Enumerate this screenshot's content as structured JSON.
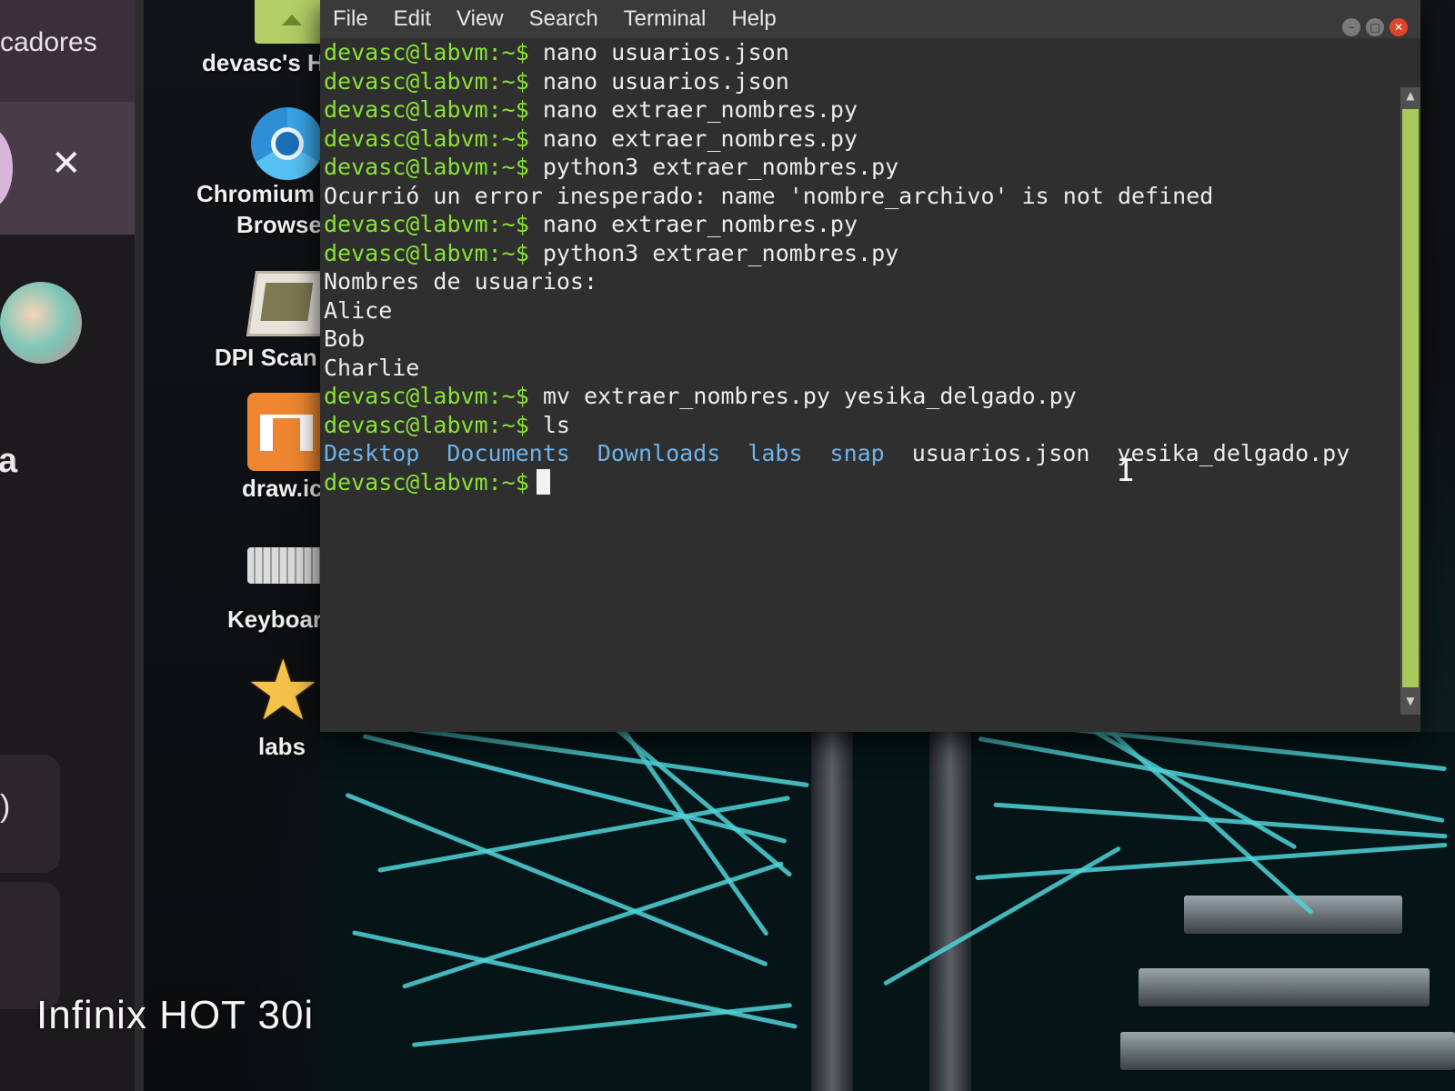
{
  "left_panel": {
    "bookmark_text": "cadores",
    "close_symbol": "✕",
    "letter": "a",
    "glyph": ")"
  },
  "desktop": {
    "items": [
      {
        "label": "devasc's H",
        "icon": "home-folder-icon"
      },
      {
        "label": "Chromium",
        "label2": "Browse",
        "icon": "chromium-icon"
      },
      {
        "label": "DPI Scan",
        "icon": "dpi-scan-icon"
      },
      {
        "label": "draw.ic",
        "icon": "drawio-icon"
      },
      {
        "label": "Keyboar",
        "icon": "keyboard-icon"
      },
      {
        "label": "labs",
        "icon": "star-icon"
      }
    ]
  },
  "terminal": {
    "menu": [
      "File",
      "Edit",
      "View",
      "Search",
      "Terminal",
      "Help"
    ],
    "prompt": "devasc@labvm:~$",
    "lines": [
      {
        "type": "cmd",
        "text": "nano usuarios.json"
      },
      {
        "type": "cmd",
        "text": "nano usuarios.json"
      },
      {
        "type": "cmd",
        "text": "nano extraer_nombres.py"
      },
      {
        "type": "cmd",
        "text": "nano extraer_nombres.py"
      },
      {
        "type": "cmd",
        "text": "python3 extraer_nombres.py"
      },
      {
        "type": "out",
        "text": "Ocurrió un error inesperado: name 'nombre_archivo' is not defined"
      },
      {
        "type": "cmd",
        "text": "nano extraer_nombres.py"
      },
      {
        "type": "cmd",
        "text": "python3 extraer_nombres.py"
      },
      {
        "type": "out",
        "text": "Nombres de usuarios:"
      },
      {
        "type": "out",
        "text": "Alice"
      },
      {
        "type": "out",
        "text": "Bob"
      },
      {
        "type": "out",
        "text": "Charlie"
      },
      {
        "type": "cmd",
        "text": "mv extraer_nombres.py yesika_delgado.py"
      },
      {
        "type": "cmd",
        "text": "ls"
      }
    ],
    "ls_output": [
      {
        "name": "Desktop",
        "kind": "dir"
      },
      {
        "name": "Documents",
        "kind": "dir"
      },
      {
        "name": "Downloads",
        "kind": "dir"
      },
      {
        "name": "labs",
        "kind": "dir"
      },
      {
        "name": "snap",
        "kind": "dir"
      },
      {
        "name": "usuarios.json",
        "kind": "file"
      },
      {
        "name": "yesika_delgado.py",
        "kind": "file"
      }
    ],
    "cursor_symbol": "I"
  },
  "colors": {
    "prompt": "#8ae234",
    "directory": "#6fb3e8",
    "terminal_bg": "#2f2f2f",
    "scroll_thumb": "#a9c95a"
  },
  "watermark": "Infinix HOT 30i"
}
